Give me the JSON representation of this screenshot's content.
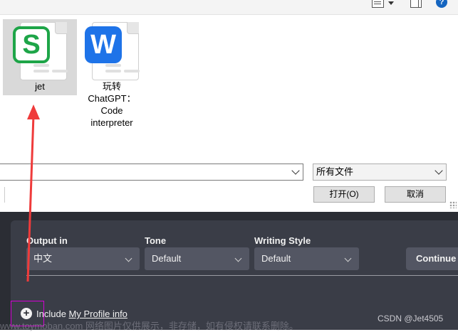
{
  "files": [
    {
      "name": "jet",
      "icon": "spreadsheet-s-icon",
      "selected": true
    },
    {
      "name": "玩转ChatGPT：Code interpreter",
      "icon": "word-w-icon",
      "selected": false
    }
  ],
  "dialog": {
    "path_value": "",
    "file_type": "所有文件",
    "open_button": "打开(O)",
    "cancel_button": "取消"
  },
  "panel": {
    "output_label": "Output in",
    "output_value": "中文",
    "tone_label": "Tone",
    "tone_value": "Default",
    "style_label": "Writing Style",
    "style_value": "Default",
    "continue_button": "Continue",
    "include_prefix": "Include",
    "include_link": "My Profile info"
  },
  "watermark": "www.toymoban.com 网络图片仅供展示，非存储，如有侵权请联系删除。",
  "credit": "CSDN @Jet4505",
  "colors": {
    "annotation_arrow": "#ef3b3b",
    "highlight_box": "#d400d4",
    "dark_bg": "#2b2d34",
    "panel_bg": "#3a3d47"
  }
}
